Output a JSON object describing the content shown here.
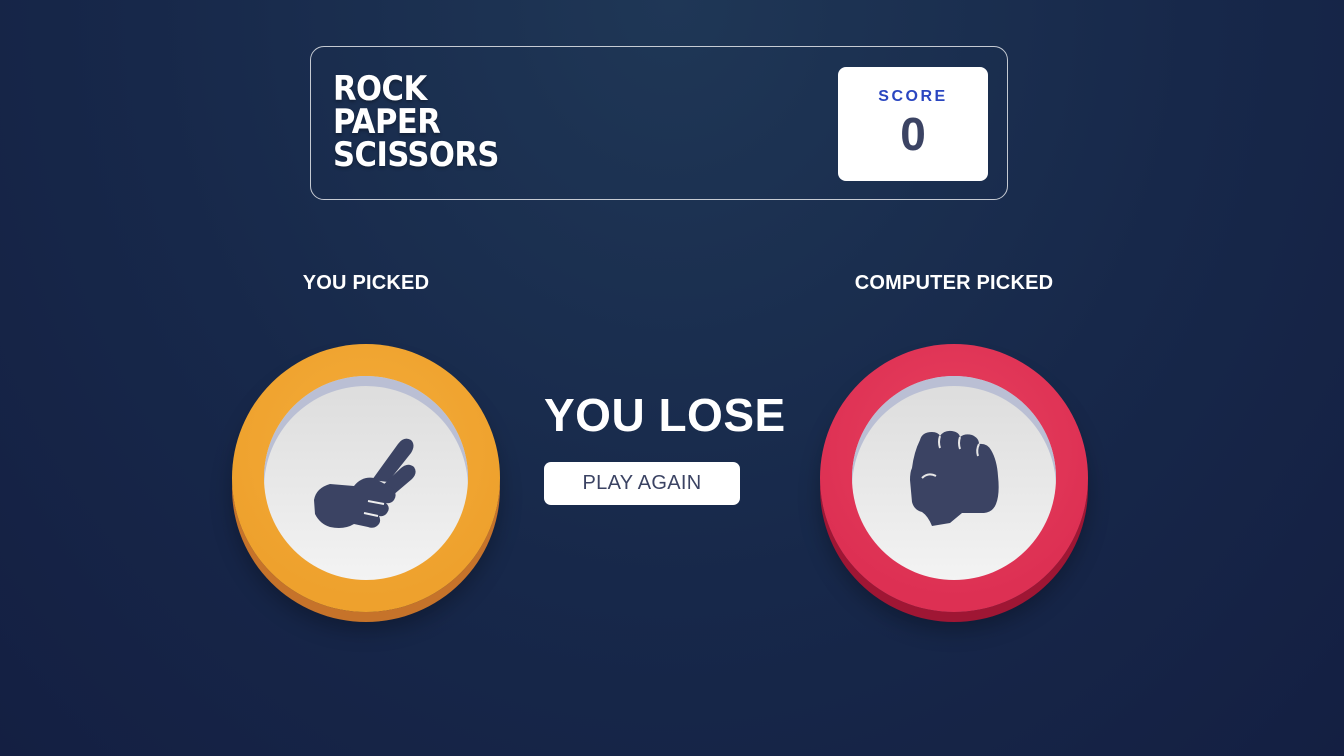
{
  "header": {
    "title_lines": [
      "ROCK",
      "PAPER",
      "SCISSORS"
    ],
    "score_label": "SCORE",
    "score_value": "0"
  },
  "player": {
    "label": "YOU PICKED",
    "choice": "scissors",
    "icon": "scissors-hand-icon",
    "color": "#eea12d"
  },
  "computer": {
    "label": "COMPUTER PICKED",
    "choice": "rock",
    "icon": "rock-fist-icon",
    "color": "#dd3053"
  },
  "result": {
    "text": "YOU LOSE",
    "button_label": "PLAY AGAIN"
  }
}
